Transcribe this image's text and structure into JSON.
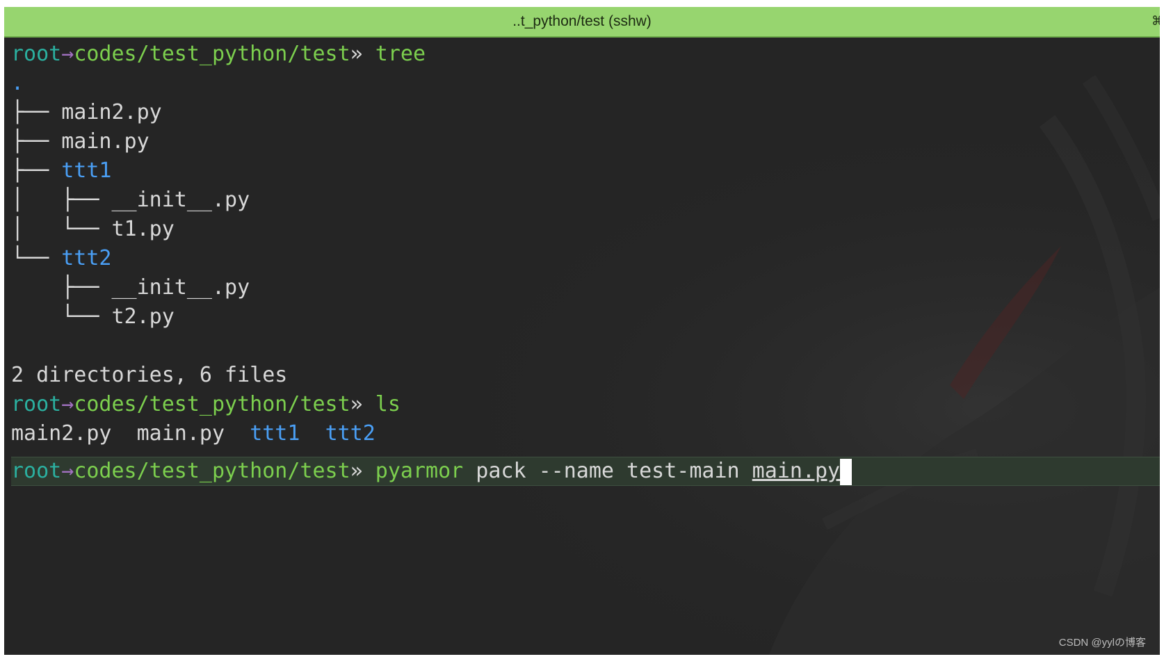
{
  "window": {
    "title": "..t_python/test (sshw)",
    "title_icon": "⌘",
    "title_icon_name": "command-icon"
  },
  "prompt": {
    "user": "root",
    "arrow": "→",
    "path": "codes/test_python/test",
    "symbol": "»"
  },
  "session": {
    "cmd1": "tree",
    "tree": {
      "root": ".",
      "lines": [
        {
          "prefix": "├── ",
          "name": "main2.py",
          "type": "file"
        },
        {
          "prefix": "├── ",
          "name": "main.py",
          "type": "file"
        },
        {
          "prefix": "├── ",
          "name": "ttt1",
          "type": "dir"
        },
        {
          "prefix": "│   ├── ",
          "name": "__init__.py",
          "type": "file"
        },
        {
          "prefix": "│   └── ",
          "name": "t1.py",
          "type": "file"
        },
        {
          "prefix": "└── ",
          "name": "ttt2",
          "type": "dir"
        },
        {
          "prefix": "    ├── ",
          "name": "__init__.py",
          "type": "file"
        },
        {
          "prefix": "    └── ",
          "name": "t2.py",
          "type": "file"
        }
      ],
      "summary": "2 directories, 6 files"
    },
    "cmd2": "ls",
    "ls_output": [
      {
        "name": "main2.py",
        "type": "file"
      },
      {
        "name": "main.py",
        "type": "file"
      },
      {
        "name": "ttt1",
        "type": "dir"
      },
      {
        "name": "ttt2",
        "type": "dir"
      }
    ],
    "cmd3": {
      "command": "pyarmor",
      "args": "pack --name test-main",
      "file": "main.py"
    }
  },
  "watermark": "CSDN @yylの博客",
  "colors": {
    "titlebar": "#97d56f",
    "background": "#252525",
    "user": "#2bb0a0",
    "path": "#7ccf4e",
    "directory": "#4a9ff5",
    "text": "#d8d8d8"
  }
}
